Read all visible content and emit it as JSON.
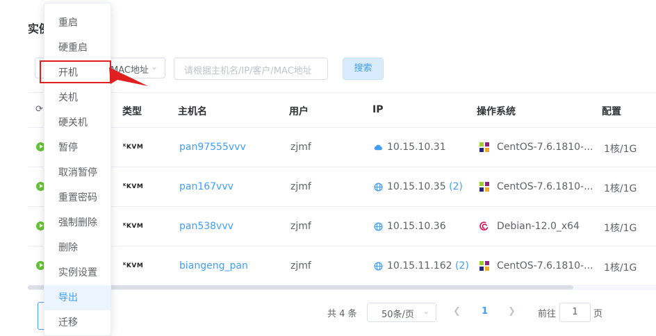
{
  "page": {
    "title": "实例"
  },
  "filter": {
    "select_value": "MAC地址",
    "search_placeholder": "请根据主机名/IP/客户/MAC地址",
    "search_button": "搜索"
  },
  "table": {
    "columns": [
      "类型",
      "主机名",
      "用户",
      "IP",
      "操作系统",
      "配置"
    ],
    "rows": [
      {
        "type": "KVM",
        "hostname": "pan97555vvv",
        "user": "zjmf",
        "ip": "10.15.10.31",
        "ip_extra": "",
        "ip_icon": "cloud-icon",
        "os": "CentOS-7.6.1810-...",
        "os_icon": "centos-logo-icon",
        "config": "1核/1G"
      },
      {
        "type": "KVM",
        "hostname": "pan167vvv",
        "user": "zjmf",
        "ip": "10.15.10.35",
        "ip_extra": "(2)",
        "ip_icon": "globe-icon",
        "os": "CentOS-7.6.1810-...",
        "os_icon": "centos-logo-icon",
        "config": "1核/1G"
      },
      {
        "type": "KVM",
        "hostname": "pan538vvv",
        "user": "zjmf",
        "ip": "10.15.10.36",
        "ip_extra": "",
        "ip_icon": "globe-icon",
        "os": "Debian-12.0_x64",
        "os_icon": "debian-logo-icon",
        "config": "1核/1G"
      },
      {
        "type": "KVM",
        "hostname": "biangeng_pan",
        "user": "zjmf",
        "ip": "10.15.11.162",
        "ip_extra": "(2)",
        "ip_icon": "globe-icon",
        "os": "CentOS-7.6.1810-...",
        "os_icon": "centos-logo-icon",
        "config": "1核/1G"
      }
    ]
  },
  "pagination": {
    "total": "共 4 条",
    "page_size": "50条/页",
    "current_page": "1",
    "goto_label": "前往",
    "goto_value": "1",
    "goto_unit": "页"
  },
  "menu": {
    "items": [
      "重启",
      "硬重启",
      "开机",
      "关机",
      "硬关机",
      "暂停",
      "取消暂停",
      "重置密码",
      "强制删除",
      "删除",
      "实例设置",
      "导出",
      "迁移"
    ],
    "highlighted_item": "开机",
    "hovered_item": "导出"
  },
  "colors": {
    "primary": "#409eff",
    "success": "#67c23a",
    "annotation": "#e02020"
  }
}
